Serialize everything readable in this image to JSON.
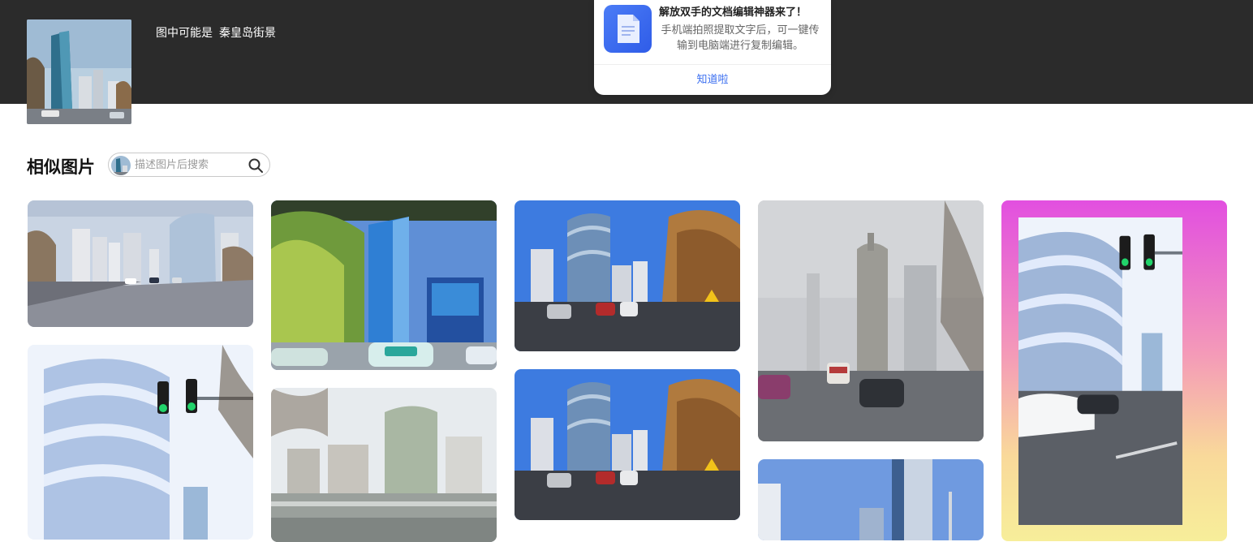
{
  "header": {
    "guess_prefix": "图中可能是",
    "guess_keyword": "秦皇岛街景"
  },
  "tip": {
    "title": "解放双手的文档编辑神器来了！",
    "description": "手机端拍照提取文字后，可一键传输到电脑端进行复制编辑。",
    "button": "知道啦"
  },
  "similar": {
    "title": "相似图片",
    "search_placeholder": "描述图片后搜索"
  },
  "colors": {
    "topbar": "#2b2b2b",
    "link_blue": "#3a6ef0",
    "sky_blue": "#3d7be0"
  }
}
